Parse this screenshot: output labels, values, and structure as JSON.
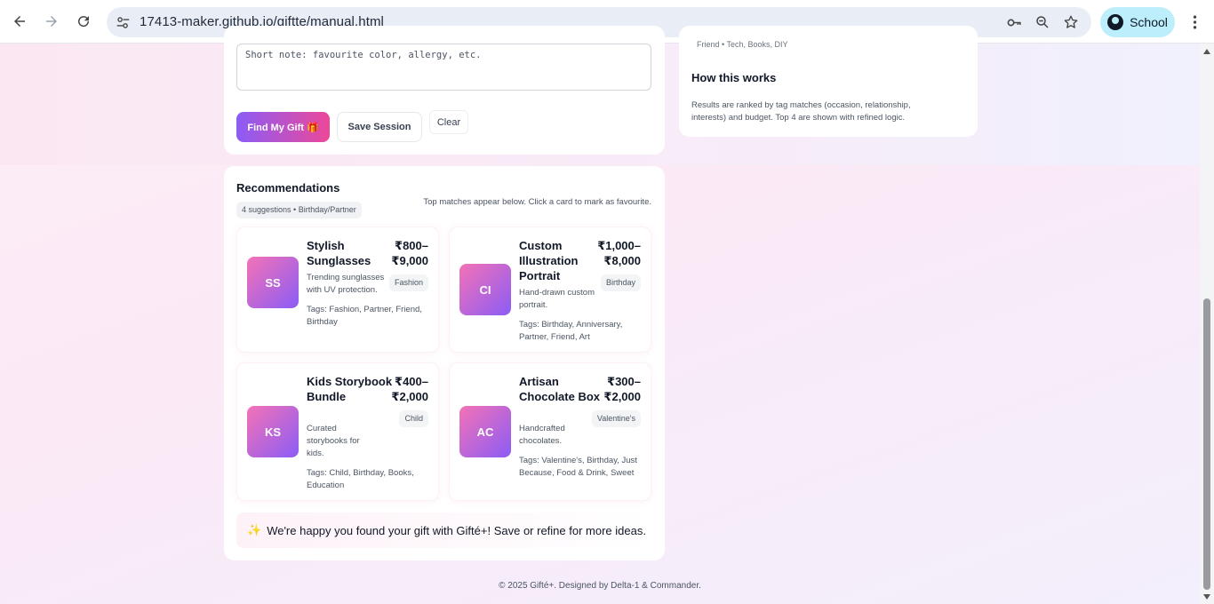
{
  "browser": {
    "url": "17413-maker.github.io/giftte/manual.html",
    "profile_label": "School"
  },
  "form": {
    "note_placeholder": "Short note: favourite color, allergy, etc.",
    "find_button": "Find My Gift 🎁",
    "save_button": "Save Session",
    "clear_button": "Clear"
  },
  "sidebar": {
    "tags_line": "Friend • Tech, Books, DIY",
    "title": "How this works",
    "text": "Results are ranked by tag matches (occasion, relationship, interests) and budget. Top 4 are shown with refined logic."
  },
  "recommendations": {
    "title": "Recommendations",
    "summary": "4 suggestions • Birthday/Partner",
    "hint": "Top matches appear below. Click a card to mark as favourite.",
    "items": [
      {
        "initials": "SS",
        "name": "Stylish Sunglasses",
        "price": "₹800–₹9,000",
        "category": "Fashion",
        "description": "Trending sunglasses with UV protection.",
        "tags": "Tags: Fashion, Partner, Friend, Birthday"
      },
      {
        "initials": "CI",
        "name": "Custom Illustration Portrait",
        "price": "₹1,000–₹8,000",
        "category": "Birthday",
        "description": "Hand-drawn custom portrait.",
        "tags": "Tags: Birthday, Anniversary, Partner, Friend, Art"
      },
      {
        "initials": "KS",
        "name": "Kids Storybook Bundle",
        "price": "₹400–₹2,000",
        "category": "Child",
        "description": "Curated storybooks for kids.",
        "tags": "Tags: Child, Birthday, Books, Education"
      },
      {
        "initials": "AC",
        "name": "Artisan Chocolate Box",
        "price": "₹300–₹2,000",
        "category": "Valentine's",
        "description": "Handcrafted chocolates.",
        "tags": "Tags: Valentine's, Birthday, Just Because, Food & Drink, Sweet"
      }
    ],
    "banner_icon": "✨",
    "banner_text": "We're happy you found your gift with Gifté+! Save or refine for more ideas."
  },
  "footer": {
    "text": "© 2025 Gifté+. Designed by Delta-1 & Commander."
  },
  "icons": {
    "back": "back-arrow-icon",
    "forward": "forward-arrow-icon",
    "reload": "reload-icon",
    "site_info": "tune-icon",
    "password": "key-icon",
    "zoom": "zoom-icon",
    "bookmark": "star-icon",
    "menu": "kebab-menu-icon",
    "sparkle": "sparkle-icon"
  },
  "colors": {
    "accent_start": "#8b5cf6",
    "accent_end": "#ec4899",
    "profile_chip": "#bdeefb"
  }
}
